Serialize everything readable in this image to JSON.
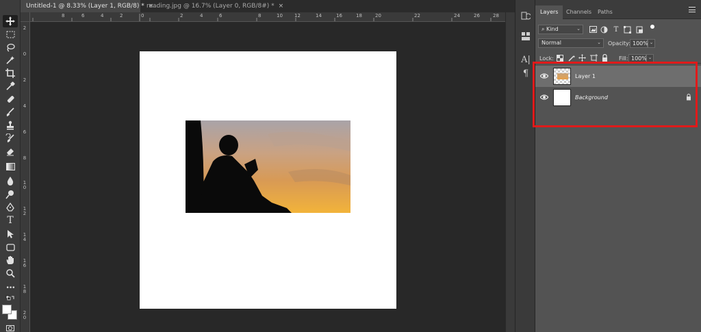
{
  "tabs": [
    {
      "label": "Untitled-1 @ 8.33% (Layer 1, RGB/8) *",
      "close": "×",
      "active": true
    },
    {
      "label": "reading.jpg @ 16.7% (Layer 0, RGB/8#) *",
      "close": "×",
      "active": false
    }
  ],
  "ruler": {
    "top_ticks": [
      "8",
      "6",
      "4",
      "2",
      "0",
      "2",
      "4",
      "6",
      "8",
      "10",
      "12",
      "14",
      "16",
      "18",
      "20",
      "22",
      "24",
      "26",
      "28"
    ],
    "left_ticks": [
      "2",
      "0",
      "2",
      "4",
      "6",
      "8",
      "1\n0",
      "1\n2",
      "1\n4",
      "1\n6",
      "1\n8",
      "2\n0"
    ]
  },
  "toolbar": {
    "tools": [
      "move-tool",
      "marquee-tool",
      "lasso-tool",
      "magic-wand-tool",
      "crop-tool",
      "eyedropper-tool",
      "healing-brush-tool",
      "brush-tool",
      "clone-stamp-tool",
      "history-brush-tool",
      "eraser-tool",
      "gradient-tool",
      "blur-tool",
      "dodge-tool",
      "pen-tool",
      "type-tool",
      "path-selection-tool",
      "rectangle-tool",
      "hand-tool",
      "zoom-tool",
      "more-tools"
    ],
    "type_glyph": "T",
    "more_glyph": "•••",
    "foreground_color": "#ffffff",
    "background_color": "#ffffff"
  },
  "dock": {
    "character_glyph": "A|",
    "paragraph_glyph": "¶"
  },
  "layers_panel": {
    "tabs": [
      "Layers",
      "Channels",
      "Paths"
    ],
    "active_tab": "Layers",
    "filter_label": "Kind",
    "blend_mode": "Normal",
    "opacity_label": "Opacity:",
    "opacity_value": "100%",
    "lock_label": "Lock:",
    "fill_label": "Fill:",
    "fill_value": "100%",
    "layers": [
      {
        "name": "Layer 1",
        "selected": true,
        "visible": true,
        "locked": false
      },
      {
        "name": "Background",
        "selected": false,
        "visible": true,
        "locked": true
      }
    ]
  },
  "colors": {
    "highlight": "#e01a1a",
    "panel_bg": "#535353",
    "workspace_bg": "#282828",
    "selected_layer": "#6e6e6e"
  }
}
